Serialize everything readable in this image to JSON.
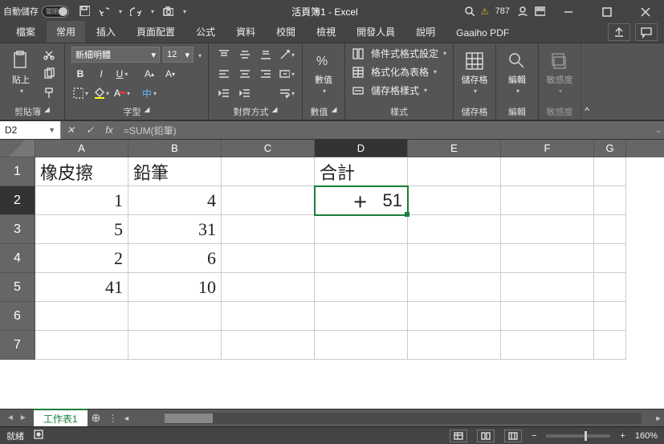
{
  "titlebar": {
    "autosave_label": "自動儲存",
    "autosave_toggle": "關閉",
    "title": "活頁簿1 - Excel",
    "warn_count": "787"
  },
  "tabs": {
    "file": "檔案",
    "home": "常用",
    "insert": "插入",
    "layout": "頁面配置",
    "formulas": "公式",
    "data": "資料",
    "review": "校閱",
    "view": "檢視",
    "developer": "開發人員",
    "help": "說明",
    "gaaiho": "Gaaiho PDF"
  },
  "ribbon": {
    "clipboard": {
      "paste": "貼上",
      "label": "剪貼簿"
    },
    "font": {
      "name": "新細明體",
      "size": "12",
      "label": "字型"
    },
    "align": {
      "label": "對齊方式"
    },
    "number": {
      "btn": "數值",
      "label": "數值"
    },
    "styles": {
      "cond": "條件式格式設定",
      "table": "格式化為表格",
      "cell": "儲存格樣式",
      "label": "樣式"
    },
    "cells": {
      "btn": "儲存格",
      "label": "儲存格"
    },
    "editing": {
      "btn": "編輯",
      "label": "編輯"
    },
    "sens": {
      "btn": "敏感度",
      "label": "敏感度"
    }
  },
  "fbar": {
    "name": "D2",
    "formula": "=SUM(鉛筆)"
  },
  "cols": [
    "A",
    "B",
    "C",
    "D",
    "E",
    "F",
    "G"
  ],
  "rows": [
    "1",
    "2",
    "3",
    "4",
    "5",
    "6",
    "7"
  ],
  "cells": {
    "A1": "橡皮擦",
    "B1": "鉛筆",
    "D1": "合計",
    "A2": "1",
    "B2": "4",
    "D2": "51",
    "A3": "5",
    "B3": "31",
    "A4": "2",
    "B4": "6",
    "A5": "41",
    "B5": "10"
  },
  "sheet": {
    "name": "工作表1"
  },
  "status": {
    "mode": "就緒",
    "zoom": "160%"
  },
  "chart_data": {
    "type": "table",
    "title": "",
    "columns": [
      "橡皮擦",
      "鉛筆",
      "",
      "合計"
    ],
    "rows": [
      [
        1,
        4,
        null,
        51
      ],
      [
        5,
        31,
        null,
        null
      ],
      [
        2,
        6,
        null,
        null
      ],
      [
        41,
        10,
        null,
        null
      ]
    ],
    "formula_D2": "=SUM(鉛筆)"
  }
}
